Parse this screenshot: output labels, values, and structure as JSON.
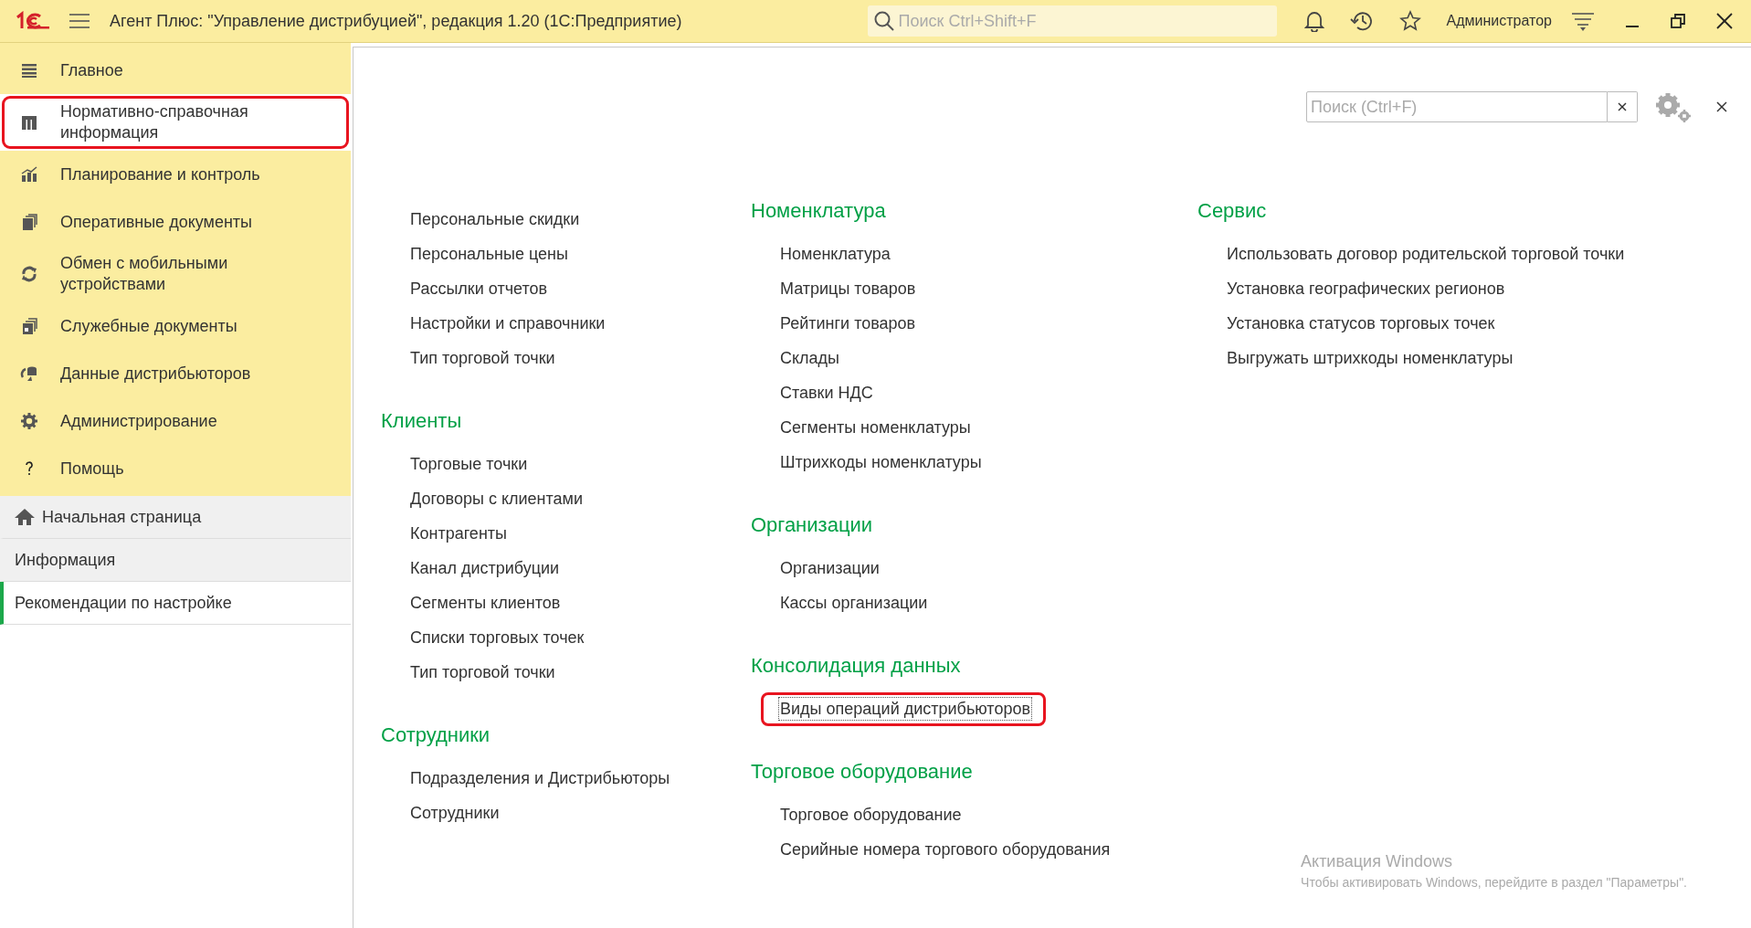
{
  "window": {
    "title": "Агент Плюс: \"Управление дистрибуцией\", редакция 1.20  (1С:Предприятие)",
    "search_placeholder": "Поиск Ctrl+Shift+F",
    "user": "Администратор"
  },
  "sections": [
    {
      "label": "Главное",
      "selected": false,
      "highlighted": false
    },
    {
      "label": "Нормативно-справочная информация",
      "selected": true,
      "highlighted": true
    },
    {
      "label": "Планирование и контроль",
      "selected": false,
      "highlighted": false
    },
    {
      "label": "Оперативные документы",
      "selected": false,
      "highlighted": false
    },
    {
      "label": "Обмен с мобильными устройствами",
      "selected": false,
      "highlighted": false
    },
    {
      "label": "Служебные документы",
      "selected": false,
      "highlighted": false
    },
    {
      "label": "Данные дистрибьюторов",
      "selected": false,
      "highlighted": false
    },
    {
      "label": "Администрирование",
      "selected": false,
      "highlighted": false
    },
    {
      "label": "Помощь",
      "selected": false,
      "highlighted": false
    }
  ],
  "open_pages": [
    {
      "label": "Начальная страница",
      "kind": "home",
      "selected": false
    },
    {
      "label": "Информация",
      "kind": "page",
      "selected": false
    },
    {
      "label": "Рекомендации по настройке",
      "kind": "page",
      "selected": true
    }
  ],
  "panel": {
    "search_placeholder": "Поиск (Ctrl+F)",
    "columns": [
      {
        "groups": [
          {
            "items": [
              {
                "label": "Персональные скидки",
                "highlighted": false
              },
              {
                "label": "Персональные цены",
                "highlighted": false
              },
              {
                "label": "Рассылки отчетов",
                "highlighted": false
              },
              {
                "label": "Настройки и справочники",
                "highlighted": false
              },
              {
                "label": "Тип торговой точки",
                "highlighted": false
              }
            ]
          },
          {
            "heading": "Клиенты",
            "items": [
              {
                "label": "Торговые точки",
                "highlighted": false
              },
              {
                "label": "Договоры с клиентами",
                "highlighted": false
              },
              {
                "label": "Контрагенты",
                "highlighted": false
              },
              {
                "label": "Канал дистрибуции",
                "highlighted": false
              },
              {
                "label": "Сегменты клиентов",
                "highlighted": false
              },
              {
                "label": "Списки торговых точек",
                "highlighted": false
              },
              {
                "label": "Тип торговой точки",
                "highlighted": false
              }
            ]
          },
          {
            "heading": "Сотрудники",
            "items": [
              {
                "label": "Подразделения и Дистрибьюторы",
                "highlighted": false
              },
              {
                "label": "Сотрудники",
                "highlighted": false
              }
            ]
          }
        ]
      },
      {
        "groups": [
          {
            "heading": "Номенклатура",
            "items": [
              {
                "label": "Номенклатура",
                "highlighted": false
              },
              {
                "label": "Матрицы товаров",
                "highlighted": false
              },
              {
                "label": "Рейтинги товаров",
                "highlighted": false
              },
              {
                "label": "Склады",
                "highlighted": false
              },
              {
                "label": "Ставки НДС",
                "highlighted": false
              },
              {
                "label": "Сегменты номенклатуры",
                "highlighted": false
              },
              {
                "label": "Штрихкоды номенклатуры",
                "highlighted": false
              }
            ]
          },
          {
            "heading": "Организации",
            "items": [
              {
                "label": "Организации",
                "highlighted": false
              },
              {
                "label": "Кассы организации",
                "highlighted": false
              }
            ]
          },
          {
            "heading": "Консолидация данных",
            "items": [
              {
                "label": "Виды операций дистрибьюторов",
                "highlighted": true
              }
            ]
          },
          {
            "heading": "Торговое оборудование",
            "items": [
              {
                "label": "Торговое оборудование",
                "highlighted": false
              },
              {
                "label": "Серийные номера торгового оборудования",
                "highlighted": false
              }
            ]
          }
        ]
      },
      {
        "groups": [
          {
            "heading": "Сервис",
            "items": [
              {
                "label": "Использовать договор родительской торговой точки",
                "highlighted": false
              },
              {
                "label": "Установка географических регионов",
                "highlighted": false
              },
              {
                "label": "Установка статусов торговых точек",
                "highlighted": false
              },
              {
                "label": "Выгружать штрихкоды номенклатуры",
                "highlighted": false
              }
            ]
          }
        ]
      }
    ]
  },
  "windows_activation": {
    "title": "Активация Windows",
    "text": "Чтобы активировать Windows, перейдите в раздел \"Параметры\"."
  }
}
